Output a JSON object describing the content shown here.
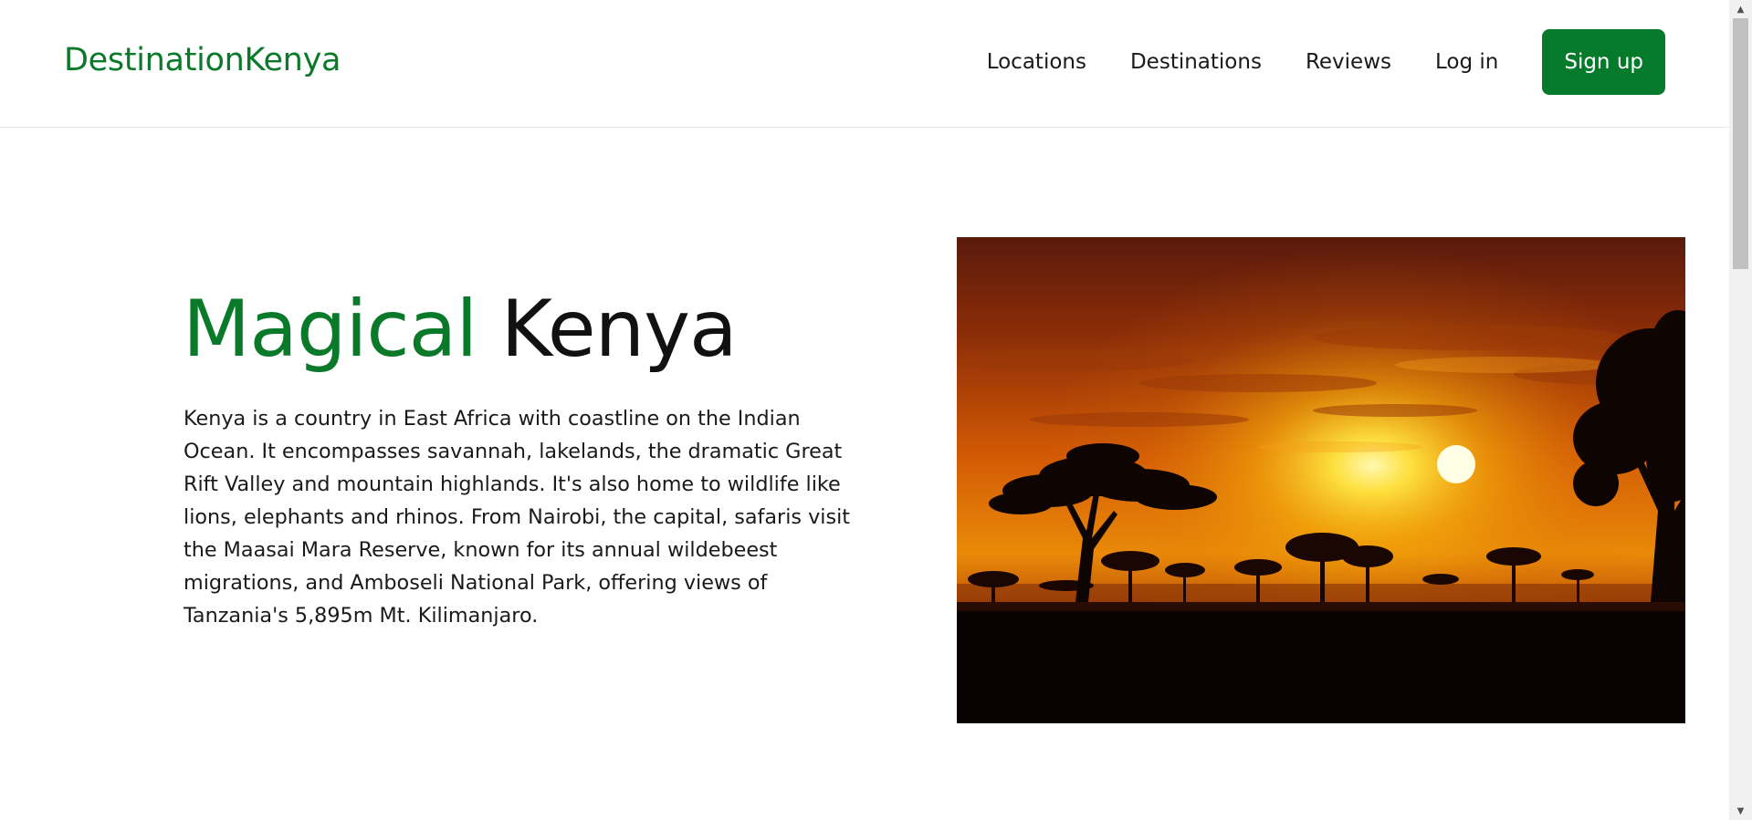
{
  "header": {
    "logo": "DestinationKenya",
    "nav": {
      "locations": "Locations",
      "destinations": "Destinations",
      "reviews": "Reviews",
      "login": "Log in",
      "signup": "Sign up"
    }
  },
  "hero": {
    "title_accent": "Magical",
    "title_rest": "Kenya",
    "description": "Kenya is a country in East Africa with coastline on the Indian Ocean. It encompasses savannah, lakelands, the dramatic Great Rift Valley and mountain highlands. It's also home to wildlife like lions, elephants and rhinos. From Nairobi, the capital, safaris visit the Maasai Mara Reserve, known for its annual wildebeest migrations, and Amboseli National Park, offering views of Tanzania's 5,895m Mt. Kilimanjaro.",
    "image": "sunset-acacia-savannah"
  },
  "colors": {
    "brand": "#0a7a2a",
    "button": "#067a2b",
    "text": "#1a1a1a"
  }
}
